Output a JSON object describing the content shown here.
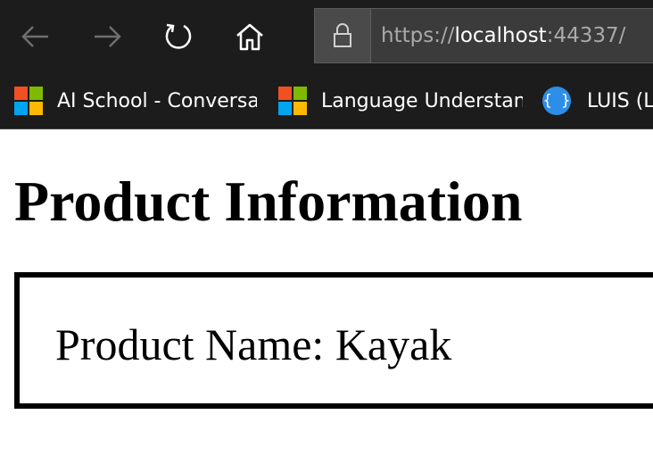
{
  "browser": {
    "url": {
      "scheme": "https://",
      "host": "localhost",
      "port_path": ":44337/"
    },
    "icons": {
      "back": "back-arrow-icon",
      "forward": "forward-arrow-icon",
      "refresh": "refresh-icon",
      "home": "home-icon",
      "lock": "lock-icon"
    }
  },
  "favorites": [
    {
      "label": "AI School - Conversat",
      "icon": "microsoft-logo-icon"
    },
    {
      "label": "Language Understanc",
      "icon": "microsoft-logo-icon"
    },
    {
      "label": "LUIS (La",
      "icon": "json-braces-icon",
      "icon_text": "{ }"
    }
  ],
  "colors": {
    "ms_red": "#f25022",
    "ms_green": "#7fba00",
    "ms_blue": "#00a4ef",
    "ms_yellow": "#ffb900",
    "json_icon_bg": "#2d8ee8"
  },
  "page": {
    "title": "Product Information",
    "product_name_line": "Product Name: Kayak"
  }
}
